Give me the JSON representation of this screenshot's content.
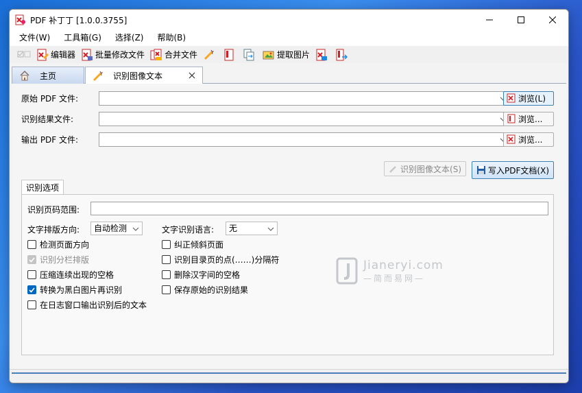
{
  "window": {
    "title": "PDF 补丁丁 [1.0.0.3755]"
  },
  "menu": [
    "文件(W)",
    "工具箱(G)",
    "选择(Z)",
    "帮助(B)"
  ],
  "toolbar": {
    "editor": "编辑器",
    "batch_modify": "批量修改文件",
    "merge": "合并文件",
    "extract_images": "提取图片"
  },
  "tabs": {
    "home": "主页",
    "ocr": "识别图像文本"
  },
  "fields": {
    "source_pdf": {
      "label": "原始 PDF 文件:",
      "value": "",
      "button": "浏览(L)"
    },
    "ocr_result": {
      "label": "识别结果文件:",
      "value": "",
      "button": "浏览..."
    },
    "output_pdf": {
      "label": "输出 PDF 文件:",
      "value": "",
      "button": "浏览..."
    }
  },
  "actions": {
    "recognize": "识别图像文本(S)",
    "write_pdf": "写入PDF文档(X)"
  },
  "options": {
    "tab_label": "识别选项",
    "page_range_label": "识别页码范围:",
    "page_range_value": "",
    "layout_direction_label": "文字排版方向:",
    "layout_direction_value": "自动检测",
    "language_label": "文字识别语言:",
    "language_value": "无",
    "checkboxes_left": [
      {
        "label": "检测页面方向",
        "checked": false,
        "disabled": false
      },
      {
        "label": "识别分栏排版",
        "checked": true,
        "disabled": true
      },
      {
        "label": "压缩连续出现的空格",
        "checked": false,
        "disabled": false
      },
      {
        "label": "转换为黑白图片再识别",
        "checked": true,
        "disabled": false
      },
      {
        "label": "在日志窗口输出识别后的文本",
        "checked": false,
        "disabled": false
      }
    ],
    "checkboxes_right": [
      {
        "label": "纠正倾斜页面",
        "checked": false,
        "disabled": false
      },
      {
        "label": "识别目录页的点(……)分隔符",
        "checked": false,
        "disabled": false
      },
      {
        "label": "删除汉字间的空格",
        "checked": false,
        "disabled": false
      },
      {
        "label": "保存原始的识别结果",
        "checked": false,
        "disabled": false
      }
    ]
  },
  "watermark": {
    "main": "Jianeryi.com",
    "sub": "—简而易网—"
  },
  "colors": {
    "accent": "#0067c0",
    "pdf_red": "#d21f26",
    "tab_blue": "#c9d8ef"
  }
}
